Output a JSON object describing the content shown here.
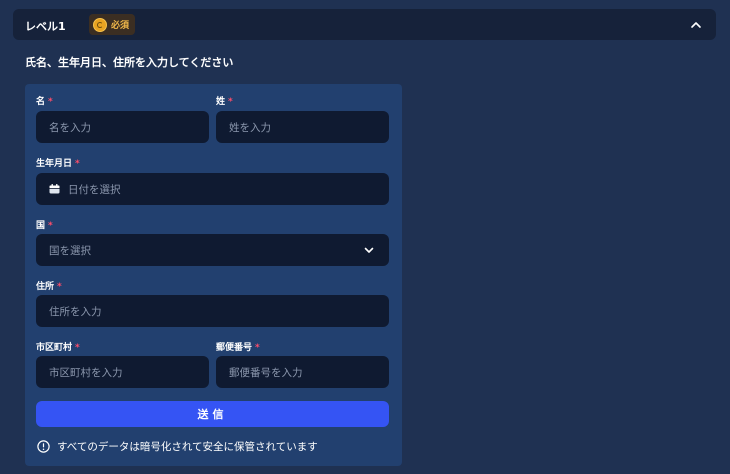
{
  "header": {
    "title": "レベル1",
    "badge_label": "必須"
  },
  "instruction": "氏名、生年月日、住所を入力してください",
  "form": {
    "first_name": {
      "label": "名",
      "placeholder": "名を入力"
    },
    "last_name": {
      "label": "姓",
      "placeholder": "姓を入力"
    },
    "birthdate": {
      "label": "生年月日",
      "placeholder": "日付を選択"
    },
    "country": {
      "label": "国",
      "placeholder": "国を選択"
    },
    "address": {
      "label": "住所",
      "placeholder": "住所を入力"
    },
    "city": {
      "label": "市区町村",
      "placeholder": "市区町村を入力"
    },
    "postal": {
      "label": "郵便番号",
      "placeholder": "郵便番号を入力"
    },
    "required_mark": "*",
    "submit_label": "送信",
    "notice": "すべてのデータは暗号化されて安全に保管されています"
  },
  "icons": {
    "badge": "coin-icon",
    "collapse": "chevron-up-icon",
    "date": "calendar-icon",
    "select": "chevron-down-icon",
    "notice": "info-icon"
  },
  "colors": {
    "background": "#1f3152",
    "header": "#16223a",
    "panel": "#22406f",
    "field": "#0f1a31",
    "accent": "#3554f4",
    "required": "#ff4d6a",
    "badge_text": "#f1b84a"
  }
}
